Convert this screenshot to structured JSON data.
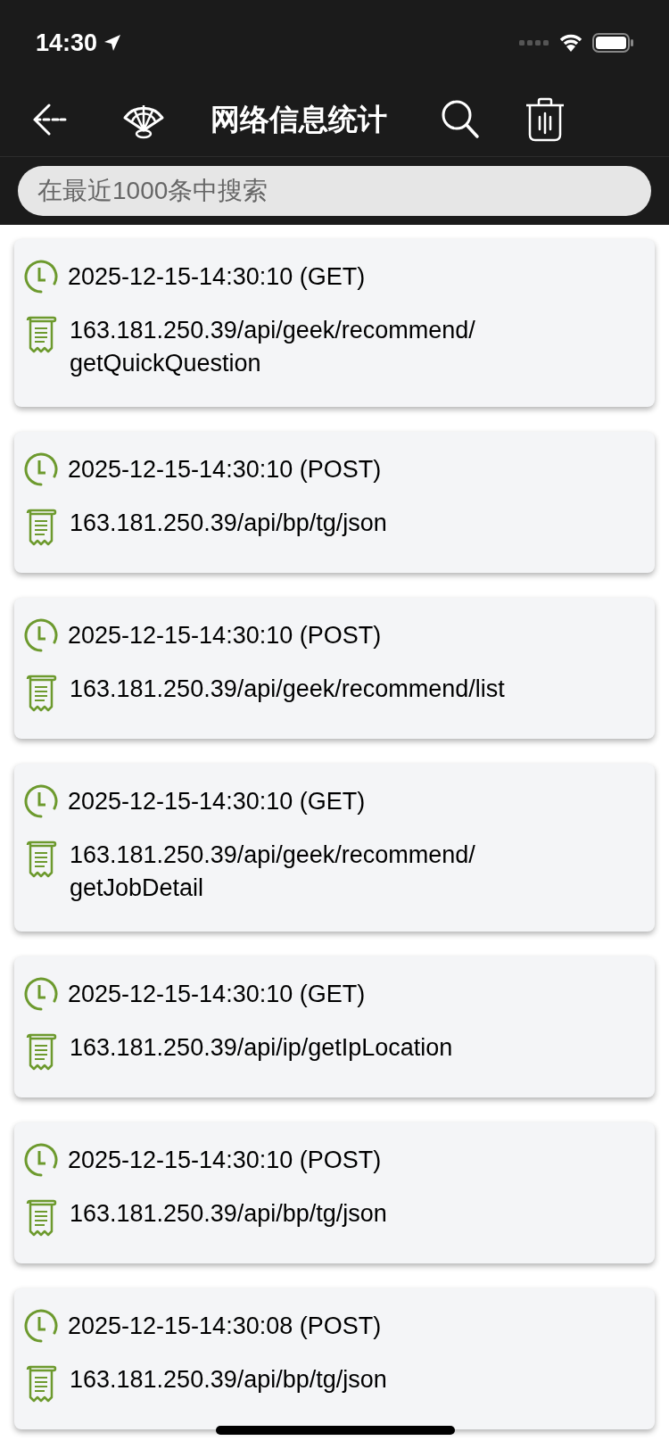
{
  "status_bar": {
    "time": "14:30"
  },
  "nav_bar": {
    "title": "网络信息统计"
  },
  "search": {
    "placeholder": "在最近1000条中搜索"
  },
  "requests": [
    {
      "time": "2025-12-15-14:30:10 (GET)",
      "url": "163.181.250.39/api/geek/recommend/\ngetQuickQuestion"
    },
    {
      "time": "2025-12-15-14:30:10 (POST)",
      "url": "163.181.250.39/api/bp/tg/json"
    },
    {
      "time": "2025-12-15-14:30:10 (POST)",
      "url": "163.181.250.39/api/geek/recommend/list"
    },
    {
      "time": "2025-12-15-14:30:10 (GET)",
      "url": "163.181.250.39/api/geek/recommend/\ngetJobDetail"
    },
    {
      "time": "2025-12-15-14:30:10 (GET)",
      "url": "163.181.250.39/api/ip/getIpLocation"
    },
    {
      "time": "2025-12-15-14:30:10 (POST)",
      "url": "163.181.250.39/api/bp/tg/json"
    },
    {
      "time": "2025-12-15-14:30:08 (POST)",
      "url": "163.181.250.39/api/bp/tg/json"
    }
  ]
}
